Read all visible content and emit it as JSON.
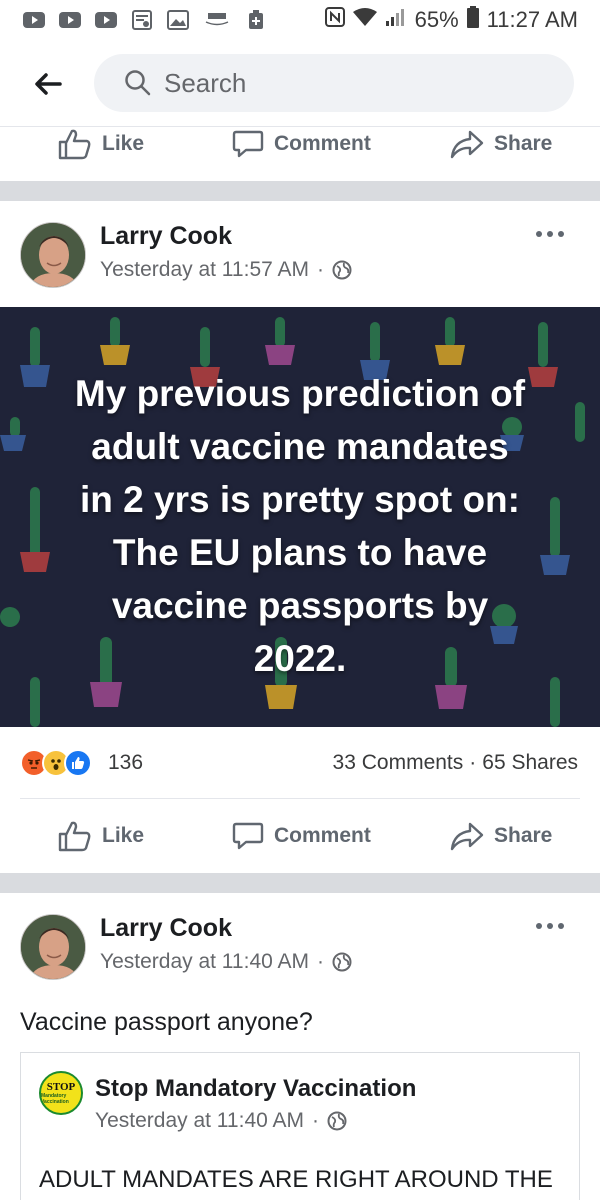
{
  "status_bar": {
    "battery": "65%",
    "time": "11:27 AM"
  },
  "search": {
    "placeholder": "Search"
  },
  "actions": {
    "like": "Like",
    "comment": "Comment",
    "share": "Share"
  },
  "post1": {
    "author": "Larry Cook",
    "timestamp": "Yesterday at 11:57 AM",
    "separator": "·",
    "image_text": "My previous prediction of adult vaccine mandates in 2 yrs is pretty spot on: The EU plans to have vaccine passports by 2022.",
    "reaction_count": "136",
    "comments": "33 Comments",
    "dot": "·",
    "shares": "65 Shares"
  },
  "post2": {
    "author": "Larry Cook",
    "timestamp": "Yesterday at 11:40 AM",
    "separator": "·",
    "body": "Vaccine passport anyone?",
    "shared": {
      "logo_text_top": "STOP",
      "logo_text_bottom": "Mandatory Vaccination",
      "page_name": "Stop Mandatory Vaccination",
      "timestamp": "Yesterday at 11:40 AM",
      "separator": "·",
      "text": "ADULT MANDATES ARE RIGHT AROUND THE CORNER"
    }
  },
  "colors": {
    "accent": "#1877f2",
    "divider_band": "#d9dbdf",
    "post_image_bg": "#1f2338"
  }
}
